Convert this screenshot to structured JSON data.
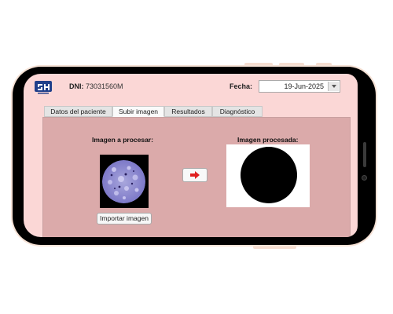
{
  "header": {
    "dni_label": "DNI:",
    "dni_value": "73031560M",
    "fecha_label": "Fecha:",
    "date_value": "19-Jun-2025"
  },
  "tabs": [
    {
      "label": "Datos del paciente",
      "active": false
    },
    {
      "label": "Subir imagen",
      "active": true
    },
    {
      "label": "Resultados",
      "active": false
    },
    {
      "label": "Diagnóstico",
      "active": false
    }
  ],
  "upload": {
    "source_label": "Imagen a procesar:",
    "output_label": "Imagen procesada:",
    "import_button": "Importar imagen",
    "process_icon": "right-arrow-icon"
  },
  "colors": {
    "screen_bg": "#fbd7d6",
    "panel_bg": "#dbaaaa",
    "arrow": "#e02020",
    "logo": "#1f3f8a"
  }
}
